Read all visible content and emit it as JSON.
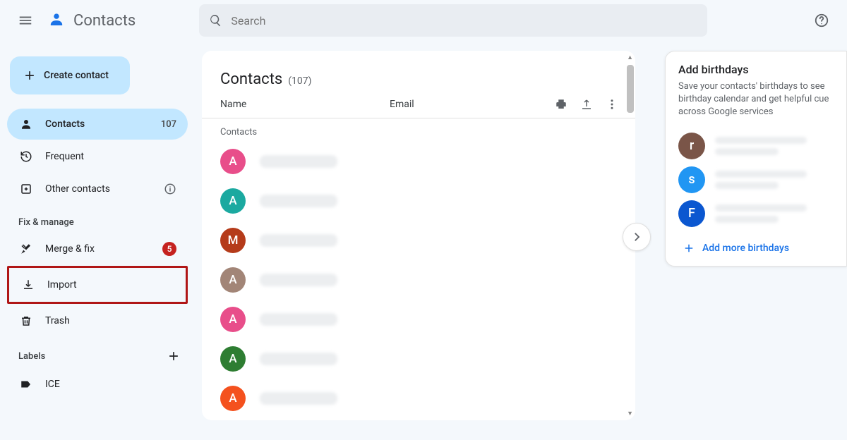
{
  "app": {
    "title": "Contacts"
  },
  "search": {
    "placeholder": "Search"
  },
  "sidebar": {
    "create_label": "Create contact",
    "items": [
      {
        "label": "Contacts",
        "count": "107"
      },
      {
        "label": "Frequent"
      },
      {
        "label": "Other contacts"
      }
    ],
    "fix_title": "Fix & manage",
    "fix_items": [
      {
        "label": "Merge & fix",
        "badge": "5"
      },
      {
        "label": "Import"
      },
      {
        "label": "Trash"
      }
    ],
    "labels_title": "Labels",
    "labels": [
      {
        "label": "ICE"
      }
    ]
  },
  "list": {
    "title": "Contacts",
    "count": "(107)",
    "col_name": "Name",
    "col_email": "Email",
    "group": "Contacts",
    "rows": [
      {
        "initial": "A",
        "color": "#e84e8a"
      },
      {
        "initial": "A",
        "color": "#1ba9a0"
      },
      {
        "initial": "M",
        "color": "#b53b1a"
      },
      {
        "initial": "A",
        "color": "#a28577"
      },
      {
        "initial": "A",
        "color": "#e84e8a"
      },
      {
        "initial": "A",
        "color": "#2e7d32"
      },
      {
        "initial": "A",
        "color": "#f4511e"
      }
    ]
  },
  "panel": {
    "title": "Add birthdays",
    "desc": "Save your contacts' birthdays to see birthday calendar and get helpful cue across Google services",
    "rows": [
      {
        "initial": "r",
        "color": "#7a5548"
      },
      {
        "initial": "s",
        "color": "#2196f3"
      },
      {
        "initial": "F",
        "color": "#0b57d0"
      }
    ],
    "add_more": "Add more birthdays"
  }
}
